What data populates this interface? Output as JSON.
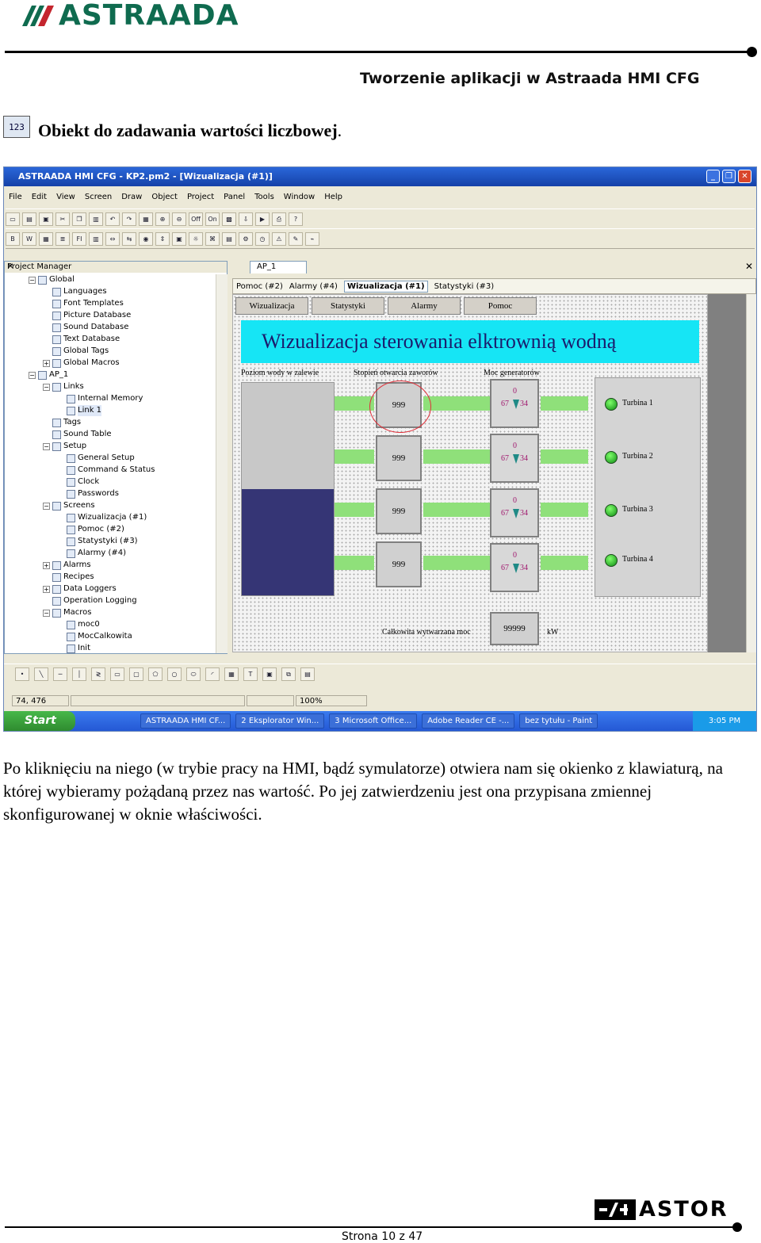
{
  "header": {
    "logo_text": "ASTRAADA",
    "title": "Tworzenie aplikacji w Astraada HMI CFG",
    "brand_color": "#0f6b4f",
    "logo_accent_color": "#c4262e"
  },
  "section": {
    "icon_text": "123",
    "title": "Obiekt do zadawania wartości liczbowej"
  },
  "app": {
    "window_title": "ASTRAADA HMI CFG - KP2.pm2 - [Wizualizacja (#1)]",
    "menu": [
      "File",
      "Edit",
      "View",
      "Screen",
      "Draw",
      "Object",
      "Project",
      "Panel",
      "Tools",
      "Window",
      "Help"
    ],
    "toolbar_labels": {
      "off": "Off",
      "on": "On",
      "bold": "B",
      "w": "W",
      "fi": "FI"
    },
    "project_manager": {
      "title": "Project Manager",
      "tree": [
        "Global",
        "Languages",
        "Font Templates",
        "Picture Database",
        "Sound Database",
        "Text Database",
        "Global Tags",
        "Global Macros",
        "AP_1",
        "Links",
        "Internal Memory",
        "Link 1",
        "Tags",
        "Sound Table",
        "Setup",
        "General Setup",
        "Command & Status",
        "Clock",
        "Passwords",
        "Screens",
        "Wizualizacja (#1)",
        "Pomoc (#2)",
        "Statystyki (#3)",
        "Alarmy (#4)",
        "Alarms",
        "Recipes",
        "Data Loggers",
        "Operation Logging",
        "Macros",
        "moc0",
        "MocCalkowita",
        "Init"
      ]
    },
    "document_tab": "AP_1",
    "screen_tabs": [
      "Pomoc (#2)",
      "Alarmy (#4)",
      "Wizualizacja (#1)",
      "Statystyki (#3)"
    ],
    "active_screen_tab": "Wizualizacja (#1)",
    "hmi": {
      "nav_buttons": [
        "Wizualizacja",
        "Statystyki",
        "Alarmy",
        "Pomoc"
      ],
      "banner": "Wizualizacja sterowania elktrownią wodną",
      "labels": {
        "water_level": "Poziom wody w zalewie",
        "valve_opening": "Stopień otwarcia zaworów",
        "generator_power": "Moc generatorów",
        "total_power": "Całkowita wytwarzana moc",
        "unit": "kW"
      },
      "valve_values": [
        "999",
        "999",
        "999",
        "999"
      ],
      "gauges": [
        {
          "top": "0",
          "left": "67",
          "right": "34"
        },
        {
          "top": "0",
          "left": "67",
          "right": "34"
        },
        {
          "top": "0",
          "left": "67",
          "right": "34"
        },
        {
          "top": "0",
          "left": "67",
          "right": "34"
        }
      ],
      "turbines": [
        "Turbina 1",
        "Turbina 2",
        "Turbina 3",
        "Turbina 4"
      ],
      "total_value": "99999",
      "water_level_fraction": 0.5,
      "tank_color": "#353575",
      "banner_color": "#16e5f5"
    },
    "status": {
      "coords": "74, 476",
      "zoom": "100%"
    },
    "taskbar": {
      "start": "Start",
      "tasks": [
        "ASTRAADA HMI CF...",
        "2 Eksplorator Win...",
        "3 Microsoft Office...",
        "Adobe Reader CE -...",
        "bez tytułu - Paint"
      ],
      "clock": "3:05 PM"
    }
  },
  "body_text": "Po kliknięciu na niego (w trybie pracy na HMI, bądź symulatorze) otwiera nam się okienko z klawiaturą, na której wybieramy pożądaną przez nas wartość. Po jej zatwierdzeniu jest ona przypisana zmiennej skonfigurowanej w oknie właściwości.",
  "footer": {
    "logo_mark": "",
    "logo_text": "ASTOR",
    "page": "Strona 10 z 47"
  }
}
